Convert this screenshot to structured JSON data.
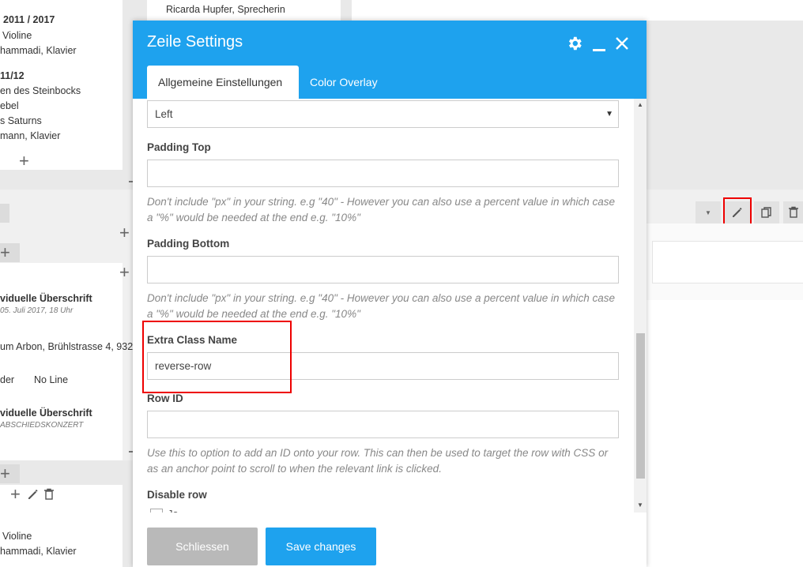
{
  "background": {
    "left_card_top_lines": [
      "2011 / 2017",
      "Violine",
      "hammadi, Klavier",
      "11/12",
      "en des Steinbocks",
      "ebel",
      "s Saturns",
      "mann, Klavier"
    ],
    "mid_card_text": "Ricarda Hupfer, Sprecherin",
    "left_middle": {
      "heading1": "viduelle Überschrift",
      "date1": "05. Juli 2017, 18 Uhr",
      "address": "um Arbon, Brühlstrasse 4, 932",
      "border_label": "der",
      "border_value": "No Line",
      "heading2": "viduelle Überschrift",
      "sub2": "ABSCHIEDSKONZERT"
    },
    "left_bottom_lines": [
      "Violine",
      "hammadi, Klavier"
    ]
  },
  "modal": {
    "title": "Zeile Settings",
    "tabs": [
      {
        "label": "Allgemeine Einstellungen"
      },
      {
        "label": "Color Overlay"
      }
    ],
    "fields": {
      "alignment_value": "Left",
      "padding_top_label": "Padding Top",
      "padding_top_value": "",
      "padding_top_help": "Don't include \"px\" in your string. e.g \"40\" - However you can also use a percent value in which case a \"%\" would be needed at the end e.g. \"10%\"",
      "padding_bottom_label": "Padding Bottom",
      "padding_bottom_value": "",
      "padding_bottom_help": "Don't include \"px\" in your string. e.g \"40\" - However you can also use a percent value in which case a \"%\" would be needed at the end e.g. \"10%\"",
      "extra_class_label": "Extra Class Name",
      "extra_class_value": "reverse-row",
      "row_id_label": "Row ID",
      "row_id_value": "",
      "row_id_help": "Use this to option to add an ID onto your row. This can then be used to target the row with CSS or as an anchor point to scroll to when the relevant link is clicked.",
      "disable_row_label": "Disable row",
      "disable_row_option": "Ja"
    },
    "buttons": {
      "close": "Schliessen",
      "save": "Save changes"
    }
  },
  "colors": {
    "accent": "#1ea2ee",
    "highlight": "#e00000",
    "close_button": "#b9b9b9"
  }
}
